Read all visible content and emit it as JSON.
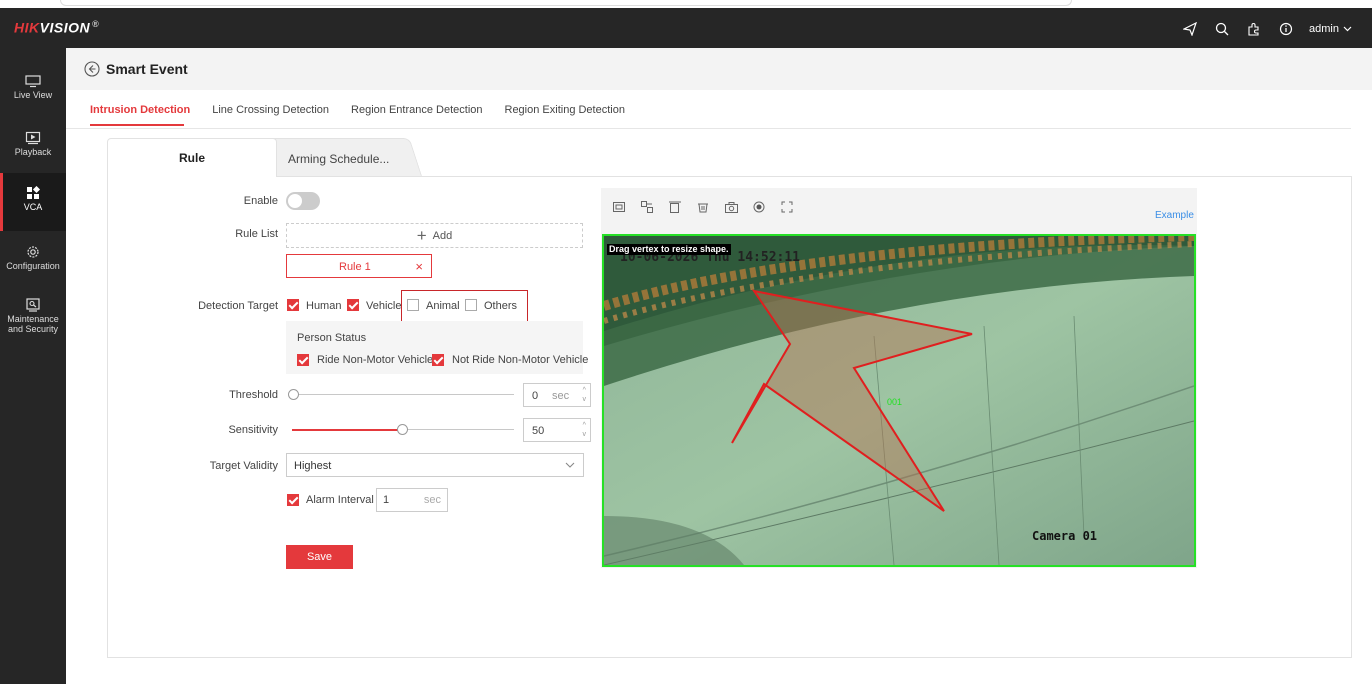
{
  "brand": {
    "name": "HIKVISION",
    "mark": "®"
  },
  "header": {
    "user": "admin"
  },
  "sidebar": {
    "items": [
      {
        "label": "Live View",
        "icon": "monitor-icon"
      },
      {
        "label": "Playback",
        "icon": "playback-icon"
      },
      {
        "label": "VCA",
        "icon": "vca-grid-icon"
      },
      {
        "label": "Configuration",
        "icon": "gear-icon"
      },
      {
        "label": "Maintenance and Security",
        "icon": "maintenance-icon"
      }
    ],
    "active": "VCA"
  },
  "page": {
    "title": "Smart Event"
  },
  "tabs": [
    {
      "label": "Intrusion Detection",
      "active": true
    },
    {
      "label": "Line Crossing Detection"
    },
    {
      "label": "Region Entrance Detection"
    },
    {
      "label": "Region Exiting Detection"
    }
  ],
  "subtabs": {
    "rule": "Rule",
    "arming": "Arming Schedule..."
  },
  "form": {
    "enable_label": "Enable",
    "enable_on": false,
    "rule_list_label": "Rule List",
    "add_label": "Add",
    "rule_chip": "Rule 1",
    "detection_target_label": "Detection Target",
    "targets": [
      {
        "label": "Human",
        "checked": true
      },
      {
        "label": "Vehicle",
        "checked": true
      },
      {
        "label": "Animal",
        "checked": false
      },
      {
        "label": "Others",
        "checked": false
      }
    ],
    "person_status_label": "Person Status",
    "person_status": [
      {
        "label": "Ride Non-Motor Vehicle",
        "checked": true
      },
      {
        "label": "Not Ride Non-Motor Vehicle",
        "checked": true
      }
    ],
    "threshold_label": "Threshold",
    "threshold_value": "0",
    "threshold_unit": "sec",
    "threshold_fraction": 0.0,
    "sensitivity_label": "Sensitivity",
    "sensitivity_value": "50",
    "sensitivity_fraction": 0.5,
    "target_validity_label": "Target Validity",
    "target_validity_value": "Highest",
    "alarm_interval_label": "Alarm Interval",
    "alarm_interval_checked": true,
    "alarm_interval_value": "1",
    "alarm_interval_unit": "sec",
    "save_label": "Save"
  },
  "video": {
    "example_label": "Example",
    "hint": "Drag vertex to resize shape.",
    "osd_time": "10-06-2026 Thu 14:52:11",
    "osd_camera": "Camera 01",
    "region_label": "001",
    "tools": [
      "snapshot-region-icon",
      "split-icon",
      "clear-icon",
      "delete-icon",
      "camera-icon",
      "record-icon",
      "fullscreen-icon"
    ]
  },
  "colors": {
    "accent": "#e4393c",
    "header_bg": "#262626",
    "region_outline": "#26e026",
    "link": "#3a8ee6"
  }
}
